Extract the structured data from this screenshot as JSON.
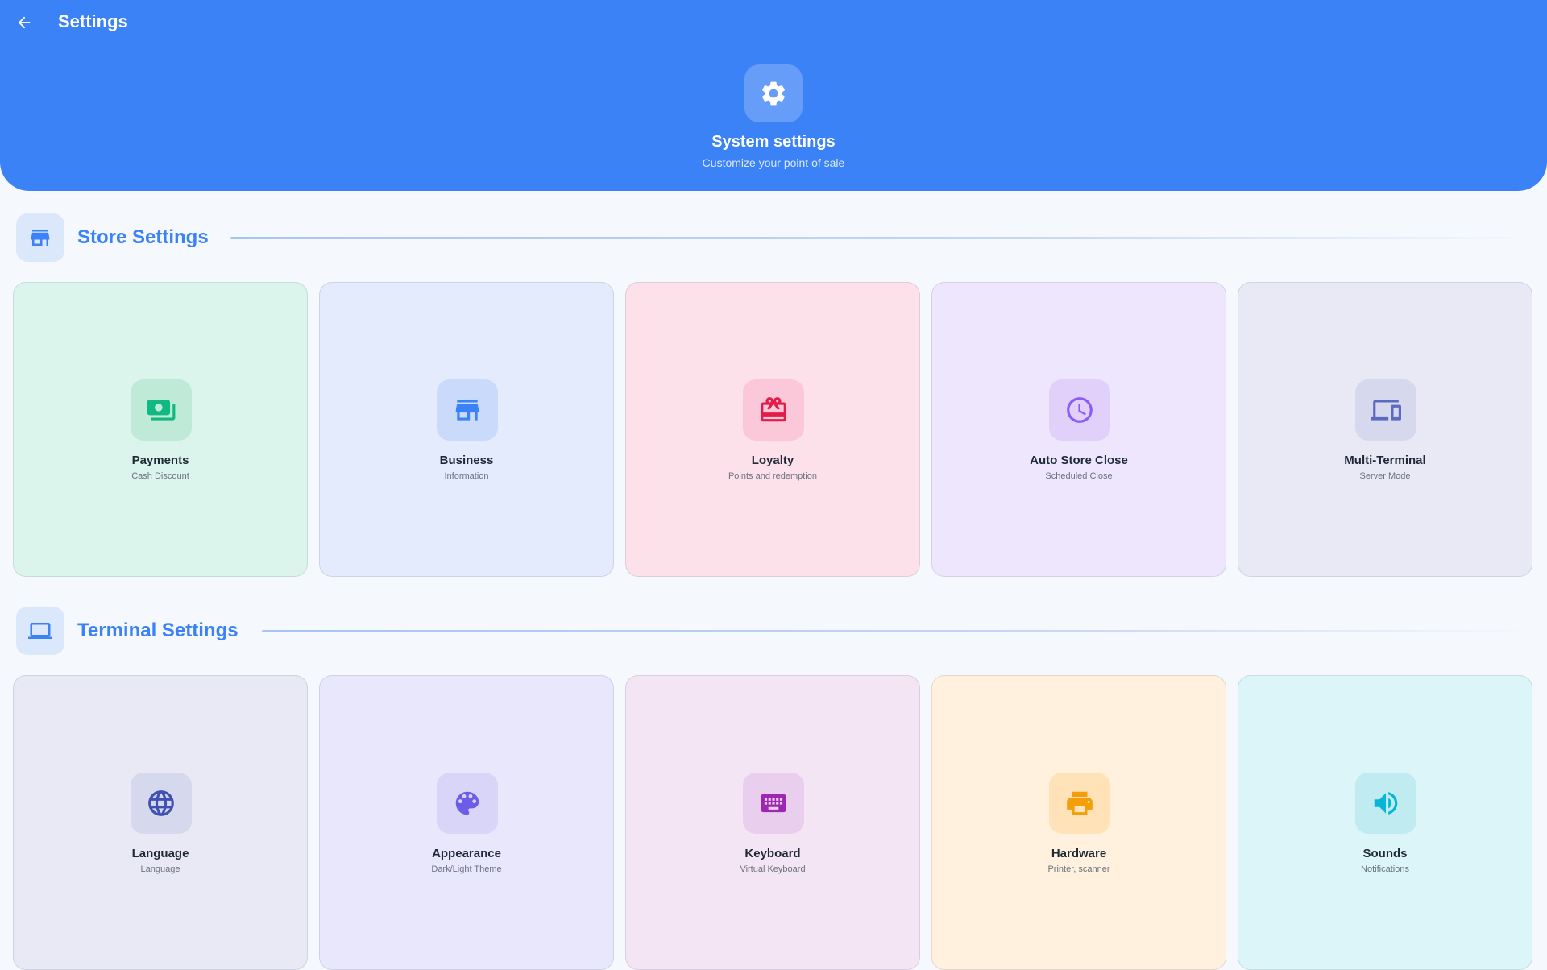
{
  "header": {
    "title": "Settings",
    "hero_title": "System settings",
    "hero_subtitle": "Customize your point of sale"
  },
  "colors": {
    "primary": "#3b82f6",
    "background": "#f5f8fc"
  },
  "sections": [
    {
      "title": "Store Settings",
      "icon": "store-icon",
      "cards": [
        {
          "label": "Payments",
          "sub": "Cash Discount",
          "icon": "payments-icon",
          "bg": "#dcf5ec",
          "icon_bg": "#c0ead8",
          "icon_color": "#10b981"
        },
        {
          "label": "Business",
          "sub": "Information",
          "icon": "store-icon",
          "bg": "#e3ebfd",
          "icon_bg": "#cadafb",
          "icon_color": "#3b82f6"
        },
        {
          "label": "Loyalty",
          "sub": "Points and redemption",
          "icon": "gift-card-icon",
          "bg": "#fde1ea",
          "icon_bg": "#fac8d8",
          "icon_color": "#e11d48"
        },
        {
          "label": "Auto Store Close",
          "sub": "Scheduled Close",
          "icon": "clock-icon",
          "bg": "#eee6fc",
          "icon_bg": "#e0d0fa",
          "icon_color": "#8b5cf6"
        },
        {
          "label": "Multi-Terminal",
          "sub": "Server Mode",
          "icon": "devices-icon",
          "bg": "#e8e9f5",
          "icon_bg": "#d6d8ee",
          "icon_color": "#5c6bc0"
        }
      ]
    },
    {
      "title": "Terminal Settings",
      "icon": "laptop-icon",
      "cards": [
        {
          "label": "Language",
          "sub": "Language",
          "icon": "globe-icon",
          "bg": "#e8e9f5",
          "icon_bg": "#d6d8ee",
          "icon_color": "#3f51b5"
        },
        {
          "label": "Appearance",
          "sub": "Dark/Light Theme",
          "icon": "palette-icon",
          "bg": "#e9e7fb",
          "icon_bg": "#d9d5f8",
          "icon_color": "#6d5ce8"
        },
        {
          "label": "Keyboard",
          "sub": "Virtual Keyboard",
          "icon": "keyboard-icon",
          "bg": "#f4e5f5",
          "icon_bg": "#eaceee",
          "icon_color": "#9c27b0"
        },
        {
          "label": "Hardware",
          "sub": "Printer, scanner",
          "icon": "printer-icon",
          "bg": "#fff1dd",
          "icon_bg": "#ffe2b8",
          "icon_color": "#f59e0b"
        },
        {
          "label": "Sounds",
          "sub": "Notifications",
          "icon": "volume-icon",
          "bg": "#dcf5f8",
          "icon_bg": "#bfebf1",
          "icon_color": "#06b6d4"
        }
      ]
    }
  ]
}
